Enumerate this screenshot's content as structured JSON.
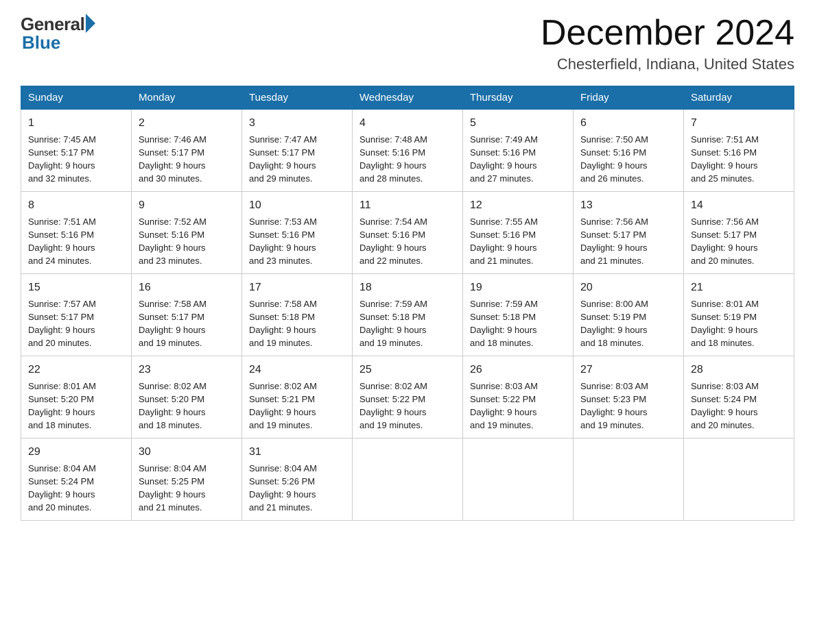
{
  "header": {
    "logo_general": "General",
    "logo_blue": "Blue",
    "month": "December 2024",
    "location": "Chesterfield, Indiana, United States"
  },
  "days_of_week": [
    "Sunday",
    "Monday",
    "Tuesday",
    "Wednesday",
    "Thursday",
    "Friday",
    "Saturday"
  ],
  "weeks": [
    [
      {
        "day": "1",
        "sunrise": "7:45 AM",
        "sunset": "5:17 PM",
        "daylight": "9 hours and 32 minutes."
      },
      {
        "day": "2",
        "sunrise": "7:46 AM",
        "sunset": "5:17 PM",
        "daylight": "9 hours and 30 minutes."
      },
      {
        "day": "3",
        "sunrise": "7:47 AM",
        "sunset": "5:17 PM",
        "daylight": "9 hours and 29 minutes."
      },
      {
        "day": "4",
        "sunrise": "7:48 AM",
        "sunset": "5:16 PM",
        "daylight": "9 hours and 28 minutes."
      },
      {
        "day": "5",
        "sunrise": "7:49 AM",
        "sunset": "5:16 PM",
        "daylight": "9 hours and 27 minutes."
      },
      {
        "day": "6",
        "sunrise": "7:50 AM",
        "sunset": "5:16 PM",
        "daylight": "9 hours and 26 minutes."
      },
      {
        "day": "7",
        "sunrise": "7:51 AM",
        "sunset": "5:16 PM",
        "daylight": "9 hours and 25 minutes."
      }
    ],
    [
      {
        "day": "8",
        "sunrise": "7:51 AM",
        "sunset": "5:16 PM",
        "daylight": "9 hours and 24 minutes."
      },
      {
        "day": "9",
        "sunrise": "7:52 AM",
        "sunset": "5:16 PM",
        "daylight": "9 hours and 23 minutes."
      },
      {
        "day": "10",
        "sunrise": "7:53 AM",
        "sunset": "5:16 PM",
        "daylight": "9 hours and 23 minutes."
      },
      {
        "day": "11",
        "sunrise": "7:54 AM",
        "sunset": "5:16 PM",
        "daylight": "9 hours and 22 minutes."
      },
      {
        "day": "12",
        "sunrise": "7:55 AM",
        "sunset": "5:16 PM",
        "daylight": "9 hours and 21 minutes."
      },
      {
        "day": "13",
        "sunrise": "7:56 AM",
        "sunset": "5:17 PM",
        "daylight": "9 hours and 21 minutes."
      },
      {
        "day": "14",
        "sunrise": "7:56 AM",
        "sunset": "5:17 PM",
        "daylight": "9 hours and 20 minutes."
      }
    ],
    [
      {
        "day": "15",
        "sunrise": "7:57 AM",
        "sunset": "5:17 PM",
        "daylight": "9 hours and 20 minutes."
      },
      {
        "day": "16",
        "sunrise": "7:58 AM",
        "sunset": "5:17 PM",
        "daylight": "9 hours and 19 minutes."
      },
      {
        "day": "17",
        "sunrise": "7:58 AM",
        "sunset": "5:18 PM",
        "daylight": "9 hours and 19 minutes."
      },
      {
        "day": "18",
        "sunrise": "7:59 AM",
        "sunset": "5:18 PM",
        "daylight": "9 hours and 19 minutes."
      },
      {
        "day": "19",
        "sunrise": "7:59 AM",
        "sunset": "5:18 PM",
        "daylight": "9 hours and 18 minutes."
      },
      {
        "day": "20",
        "sunrise": "8:00 AM",
        "sunset": "5:19 PM",
        "daylight": "9 hours and 18 minutes."
      },
      {
        "day": "21",
        "sunrise": "8:01 AM",
        "sunset": "5:19 PM",
        "daylight": "9 hours and 18 minutes."
      }
    ],
    [
      {
        "day": "22",
        "sunrise": "8:01 AM",
        "sunset": "5:20 PM",
        "daylight": "9 hours and 18 minutes."
      },
      {
        "day": "23",
        "sunrise": "8:02 AM",
        "sunset": "5:20 PM",
        "daylight": "9 hours and 18 minutes."
      },
      {
        "day": "24",
        "sunrise": "8:02 AM",
        "sunset": "5:21 PM",
        "daylight": "9 hours and 19 minutes."
      },
      {
        "day": "25",
        "sunrise": "8:02 AM",
        "sunset": "5:22 PM",
        "daylight": "9 hours and 19 minutes."
      },
      {
        "day": "26",
        "sunrise": "8:03 AM",
        "sunset": "5:22 PM",
        "daylight": "9 hours and 19 minutes."
      },
      {
        "day": "27",
        "sunrise": "8:03 AM",
        "sunset": "5:23 PM",
        "daylight": "9 hours and 19 minutes."
      },
      {
        "day": "28",
        "sunrise": "8:03 AM",
        "sunset": "5:24 PM",
        "daylight": "9 hours and 20 minutes."
      }
    ],
    [
      {
        "day": "29",
        "sunrise": "8:04 AM",
        "sunset": "5:24 PM",
        "daylight": "9 hours and 20 minutes."
      },
      {
        "day": "30",
        "sunrise": "8:04 AM",
        "sunset": "5:25 PM",
        "daylight": "9 hours and 21 minutes."
      },
      {
        "day": "31",
        "sunrise": "8:04 AM",
        "sunset": "5:26 PM",
        "daylight": "9 hours and 21 minutes."
      },
      null,
      null,
      null,
      null
    ]
  ],
  "labels": {
    "sunrise": "Sunrise: ",
    "sunset": "Sunset: ",
    "daylight": "Daylight: "
  }
}
